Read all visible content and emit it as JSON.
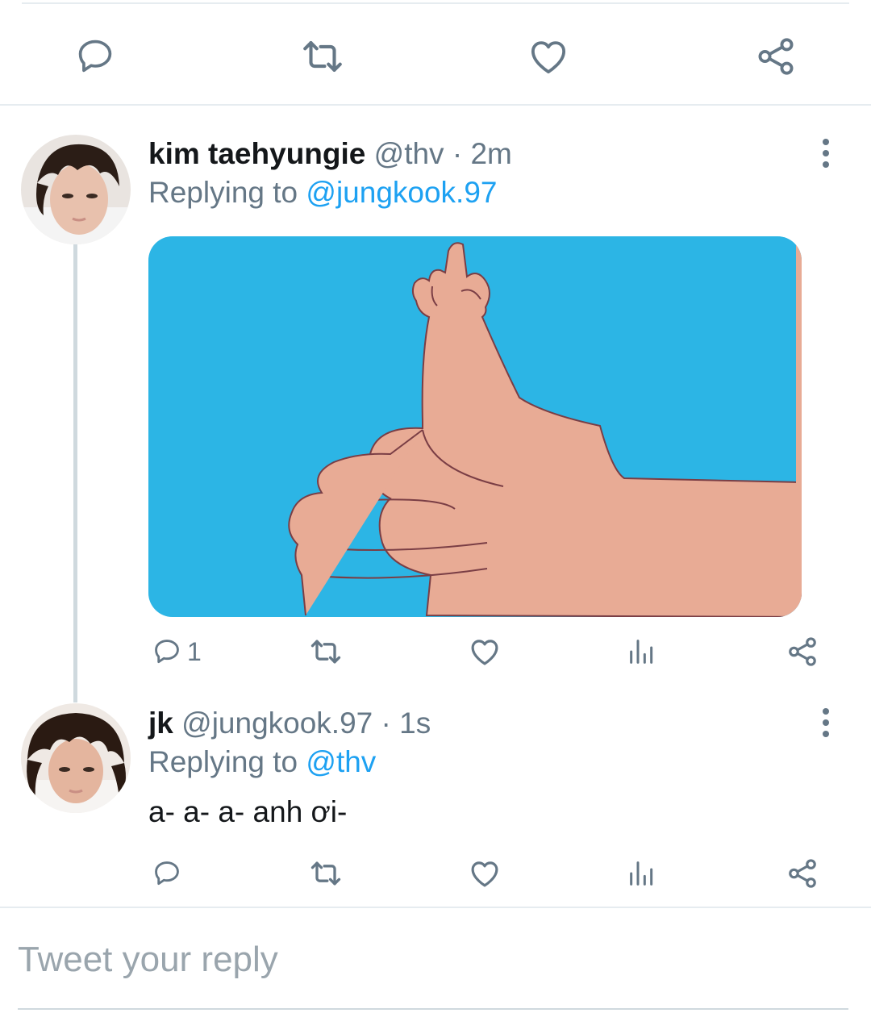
{
  "tweets": [
    {
      "name": "kim taehyungie",
      "handle": "@thv",
      "time": "· 2m",
      "replying_prefix": "Replying to ",
      "replying_to": "@jungkook.97",
      "reply_count": "1",
      "avatar": "avatar-kim-taehyungie",
      "media": "thumbs-up-middle-finger-cartoon"
    },
    {
      "name": "jk",
      "handle": "@jungkook.97",
      "time": "· 1s",
      "replying_prefix": "Replying to ",
      "replying_to": "@thv",
      "text": "a- a- a- anh ơi-",
      "avatar": "avatar-jk"
    }
  ],
  "compose": {
    "placeholder": "Tweet your reply"
  },
  "icons": {
    "reply": "reply-icon",
    "retweet": "retweet-icon",
    "like": "like-icon",
    "analytics": "analytics-icon",
    "share": "share-icon",
    "more": "more-vertical-icon"
  },
  "colors": {
    "accent": "#1da1f2",
    "icon": "#657786",
    "text": "#14171a",
    "media_bg": "#29b2e4",
    "skin": "#e8ab95"
  }
}
